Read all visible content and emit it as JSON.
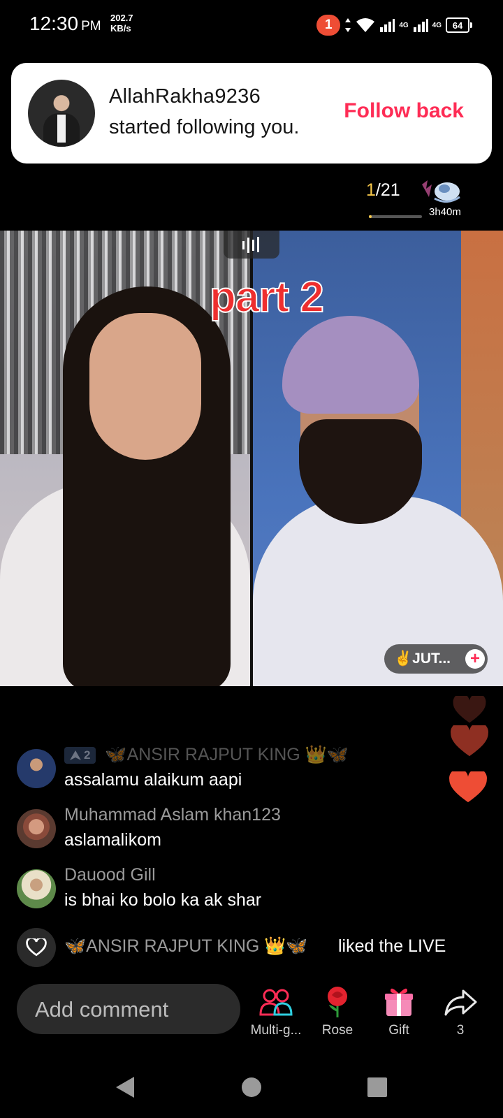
{
  "status_bar": {
    "time": "12:30",
    "ampm": "PM",
    "net_speed_value": "202.7",
    "net_speed_unit": "KB/s",
    "notification_count": "1",
    "signal_label_1": "4G",
    "signal_label_2": "4G",
    "battery": "64"
  },
  "follow_notification": {
    "username": "AllahRakha9236",
    "message": "started following you.",
    "action_label": "Follow back"
  },
  "live_header": {
    "rank_current": "1",
    "rank_total": "/21",
    "rank_progress": 0.05,
    "timer": "3h40m"
  },
  "video": {
    "overlay_text": "part 2",
    "guest_tag": "✌️JUT...",
    "guest_add": "+"
  },
  "comments": [
    {
      "name": "ANSIR RAJPUT KING",
      "name_prefix": "🦋",
      "name_suffix": "👑🦋",
      "level": "2",
      "text": "assalamu alaikum aapi"
    },
    {
      "name": "Muhammad Aslam khan123",
      "text": "aslamalikom"
    },
    {
      "name": "Dauood Gill",
      "text": "is bhai ko bolo ka ak shar"
    }
  ],
  "liked_event": {
    "name": "🦋ANSIR RAJPUT KING 👑🦋",
    "text": "liked the LIVE"
  },
  "bottom_bar": {
    "comment_placeholder": "Add comment",
    "actions": [
      {
        "label": "Multi-g...",
        "icon": "multi-guest-icon"
      },
      {
        "label": "Rose",
        "icon": "rose-icon"
      },
      {
        "label": "Gift",
        "icon": "gift-icon"
      },
      {
        "label": "3",
        "icon": "share-icon"
      }
    ]
  },
  "colors": {
    "accent": "#fe2c55",
    "heart": "#ee4d35",
    "rank_highlight": "#f7c84a"
  }
}
